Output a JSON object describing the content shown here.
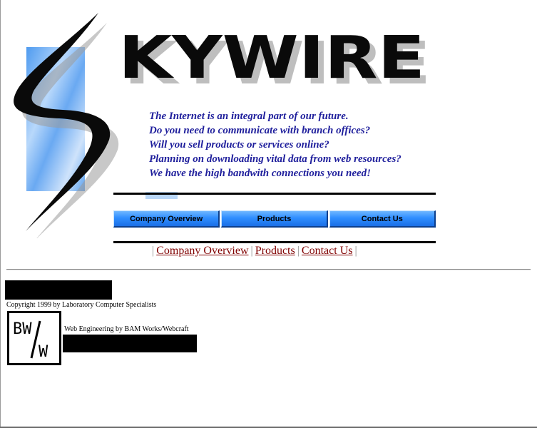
{
  "header": {
    "logo_text": "KYWIRE",
    "logo_icon": "lightning-s-icon"
  },
  "tagline": {
    "lines": [
      "The Internet is an integral part of our future.",
      "Do you need to communicate with branch offices?",
      "Will you sell products or services online?",
      "Planning on downloading vital data from web resources?",
      "We have the high bandwith connections you need!"
    ]
  },
  "navbar": {
    "buttons": [
      {
        "label": "Company Overview"
      },
      {
        "label": "Products"
      },
      {
        "label": "Contact Us"
      }
    ]
  },
  "text_nav": {
    "separator": "|",
    "links": [
      {
        "label": "Company Overview"
      },
      {
        "label": "Products"
      },
      {
        "label": "Contact Us"
      }
    ]
  },
  "footer": {
    "copyright": "Copyright 1999 by Laboratory Computer Specialists",
    "web_engineering": "Web Engineering by BAM Works/Webcraft",
    "bam_logo_icon": "bam-works-icon",
    "bam_logo_text": "BW/W"
  },
  "colors": {
    "tagline_text": "#1f1f9c",
    "nav_button": "#2f8eff",
    "link": "#800000",
    "sky_panel": "#7fb6f0"
  }
}
